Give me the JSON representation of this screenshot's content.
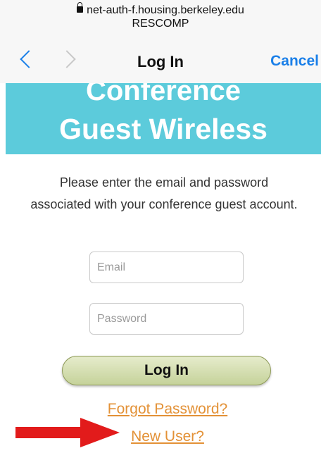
{
  "browser": {
    "url": "net-auth-f.housing.berkeley.edu",
    "network_name": "RESCOMP",
    "lock_icon": "lock-icon"
  },
  "nav": {
    "back_icon": "chevron-left-icon",
    "forward_icon": "chevron-right-icon",
    "title": "Log In",
    "cancel_label": "Cancel",
    "accent_color": "#1a7fe8"
  },
  "banner": {
    "line1": "Conference",
    "line2": "Guest Wireless",
    "background_color": "#5ccbdb"
  },
  "form": {
    "instructions": "Please enter the email and password associated with your conference guest account.",
    "email": {
      "value": "",
      "placeholder": "Email"
    },
    "password": {
      "value": "",
      "placeholder": "Password"
    },
    "login_label": "Log In",
    "forgot_label": "Forgot Password?",
    "new_user_label": "New User?",
    "link_color": "#e39136"
  },
  "annotation": {
    "arrow_icon": "red-arrow-icon",
    "arrow_color": "#e21b1b"
  }
}
